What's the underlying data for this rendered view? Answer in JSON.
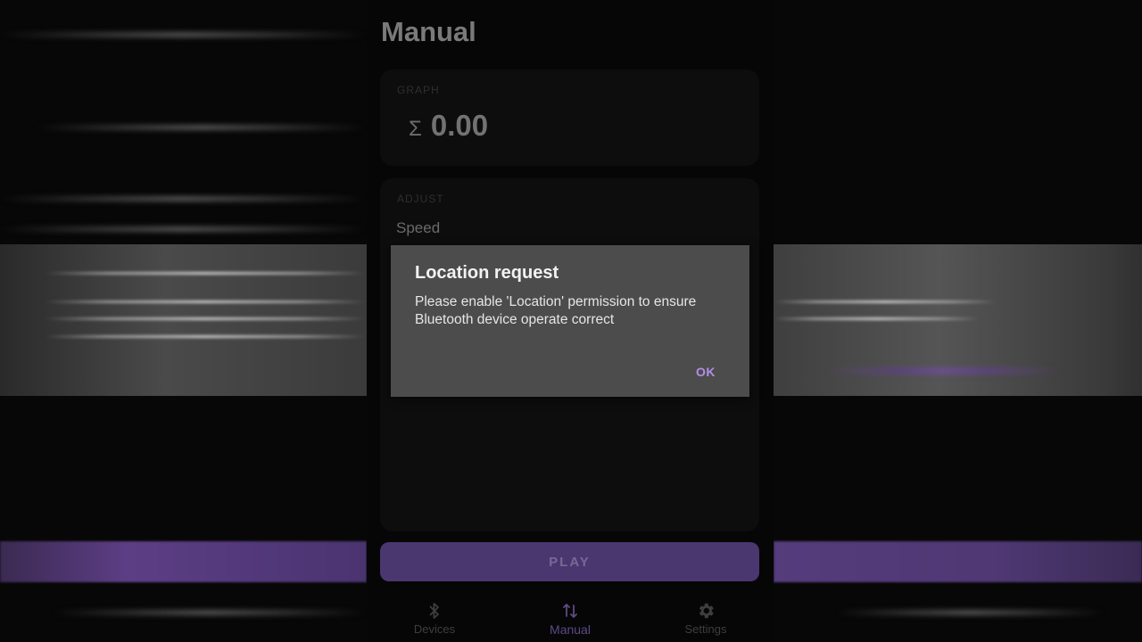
{
  "screen": {
    "title": "Manual"
  },
  "graph": {
    "label": "GRAPH",
    "sum_symbol": "Σ",
    "sum_value": "0.00"
  },
  "adjust": {
    "label": "ADJUST",
    "speed_label": "Speed"
  },
  "play_button": {
    "label": "PLAY"
  },
  "bottom_nav": {
    "items": [
      {
        "label": "Devices",
        "icon": "bluetooth-icon"
      },
      {
        "label": "Manual",
        "icon": "swap-vertical-icon",
        "active": true
      },
      {
        "label": "Settings",
        "icon": "gear-icon"
      }
    ]
  },
  "dialog": {
    "title": "Location request",
    "message": "Please enable 'Location' permission to ensure Bluetooth device operate correct",
    "ok_label": "OK"
  },
  "colors": {
    "accent": "#b38ee6",
    "play_bg": "#4a3770",
    "dialog_bg": "#4c4c4c",
    "background": "#050505"
  }
}
